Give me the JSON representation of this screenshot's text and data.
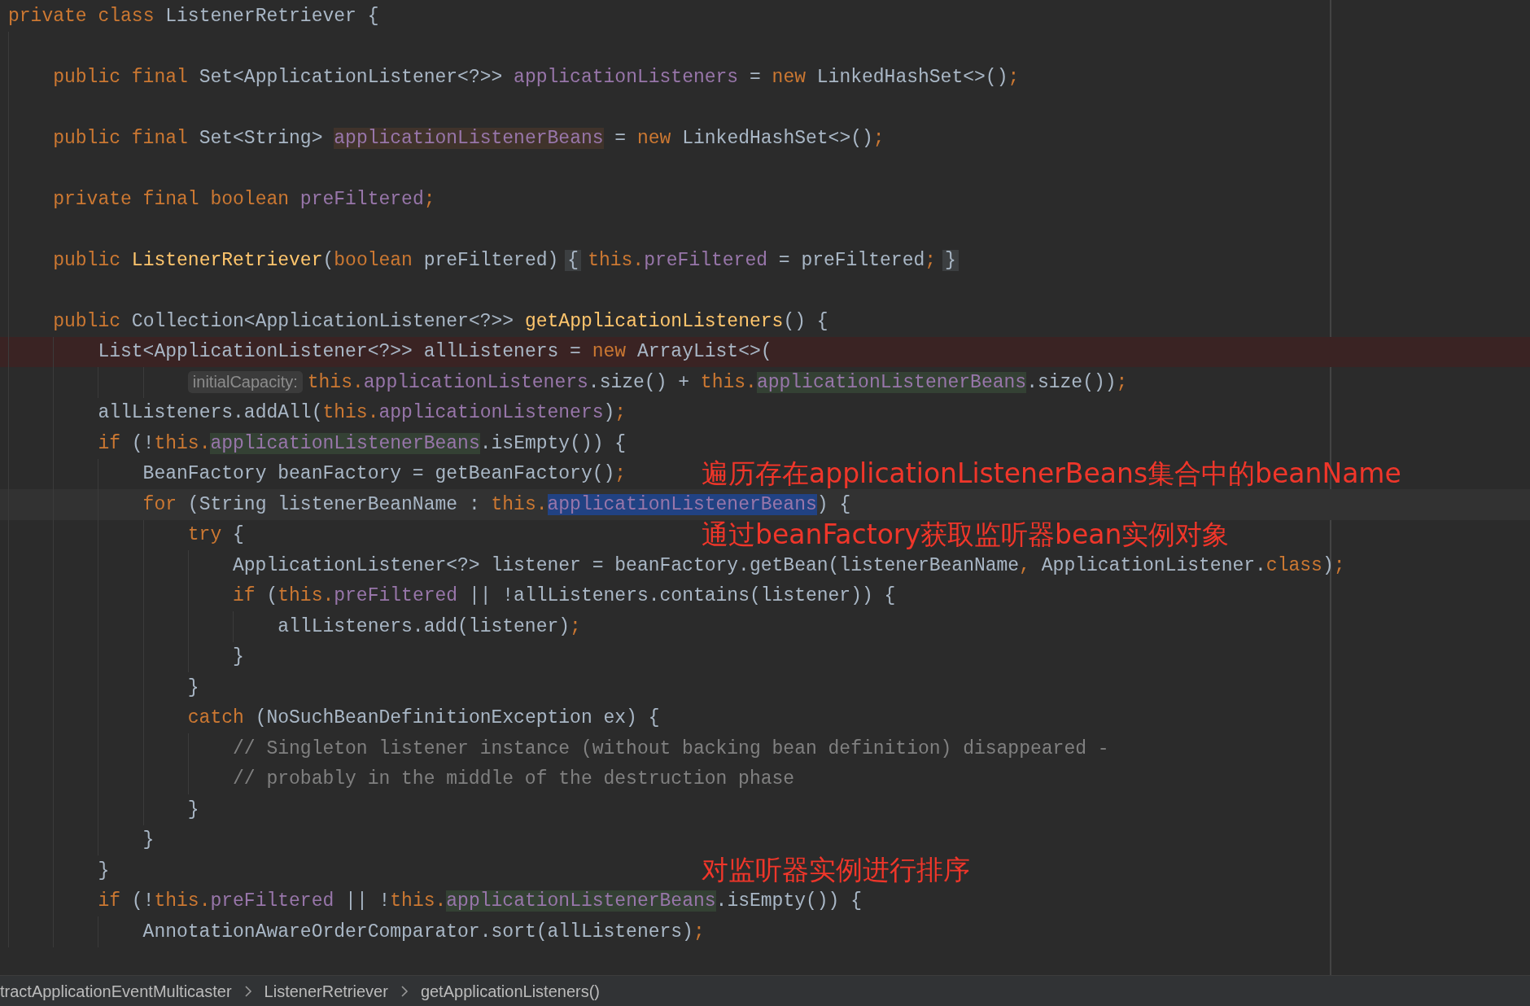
{
  "code": {
    "kind": "code",
    "tokens": [
      {
        "text": "private class ",
        "kind": "keyword"
      },
      {
        "text": "ListenerRetriever {",
        "kind": "plain"
      }
    ],
    "children": [
      {
        "kind": "blank"
      },
      {
        "kind": "code",
        "tokens": [
          {
            "text": "public final ",
            "kind": "keyword"
          },
          {
            "text": "Set<ApplicationListener<?>> ",
            "kind": "plain"
          },
          {
            "text": "applicationListeners",
            "kind": "field"
          },
          {
            "text": " = ",
            "kind": "plain"
          },
          {
            "text": "new ",
            "kind": "keyword"
          },
          {
            "text": "LinkedHashSet<>()",
            "kind": "plain"
          },
          {
            "text": ";",
            "kind": "keyword"
          }
        ]
      },
      {
        "kind": "blank"
      },
      {
        "kind": "code",
        "tokens": [
          {
            "text": "public final ",
            "kind": "keyword"
          },
          {
            "text": "Set<String> ",
            "kind": "plain"
          },
          {
            "text": "applicationListenerBeans",
            "kind": "field",
            "highlighted": true,
            "write_access": true
          },
          {
            "text": " = ",
            "kind": "plain"
          },
          {
            "text": "new ",
            "kind": "keyword"
          },
          {
            "text": "LinkedHashSet<>()",
            "kind": "plain"
          },
          {
            "text": ";",
            "kind": "keyword"
          }
        ]
      },
      {
        "kind": "blank"
      },
      {
        "kind": "code",
        "tokens": [
          {
            "text": "private final boolean ",
            "kind": "keyword"
          },
          {
            "text": "preFiltered",
            "kind": "field"
          },
          {
            "text": ";",
            "kind": "keyword"
          }
        ]
      },
      {
        "kind": "blank"
      },
      {
        "kind": "code",
        "tokens": [
          {
            "text": "public ",
            "kind": "keyword"
          },
          {
            "text": "ListenerRetriever",
            "kind": "method"
          },
          {
            "text": "(",
            "kind": "plain"
          },
          {
            "text": "boolean ",
            "kind": "keyword"
          },
          {
            "text": "preFiltered)",
            "kind": "plain"
          },
          {
            "text": "{",
            "kind": "fold"
          },
          {
            "text": "this.",
            "kind": "keyword"
          },
          {
            "text": "preFiltered",
            "kind": "field"
          },
          {
            "text": " = preFiltered",
            "kind": "plain"
          },
          {
            "text": ";",
            "kind": "keyword"
          },
          {
            "text": "}",
            "kind": "fold"
          }
        ]
      },
      {
        "kind": "blank"
      },
      {
        "kind": "code",
        "tokens": [
          {
            "text": "public ",
            "kind": "keyword"
          },
          {
            "text": "Collection<ApplicationListener<?>> ",
            "kind": "plain"
          },
          {
            "text": "getApplicationListeners",
            "kind": "method"
          },
          {
            "text": "() {",
            "kind": "plain"
          }
        ],
        "children": [
          {
            "kind": "breakpoint",
            "tokens": [
              {
                "text": "List<ApplicationListener<?>> allListeners = ",
                "kind": "plain"
              },
              {
                "text": "new ",
                "kind": "keyword"
              },
              {
                "text": "ArrayList<>(",
                "kind": "plain"
              }
            ],
            "continuation": {
              "hint": "initialCapacity:",
              "tokens": [
                {
                  "text": "this.",
                  "kind": "keyword"
                },
                {
                  "text": "applicationListeners",
                  "kind": "field"
                },
                {
                  "text": ".size() + ",
                  "kind": "plain"
                },
                {
                  "text": "this.",
                  "kind": "keyword"
                },
                {
                  "text": "applicationListenerBeans",
                  "kind": "field",
                  "highlighted": true
                },
                {
                  "text": ".size())",
                  "kind": "plain"
                },
                {
                  "text": ";",
                  "kind": "keyword"
                }
              ]
            }
          },
          {
            "kind": "code",
            "tokens": [
              {
                "text": "allListeners.addAll(",
                "kind": "plain"
              },
              {
                "text": "this.",
                "kind": "keyword"
              },
              {
                "text": "applicationListeners",
                "kind": "field"
              },
              {
                "text": ")",
                "kind": "plain"
              },
              {
                "text": ";",
                "kind": "keyword"
              }
            ]
          },
          {
            "kind": "code",
            "tokens": [
              {
                "text": "if ",
                "kind": "keyword"
              },
              {
                "text": "(!",
                "kind": "plain"
              },
              {
                "text": "this.",
                "kind": "keyword"
              },
              {
                "text": "applicationListenerBeans",
                "kind": "field",
                "highlighted": true
              },
              {
                "text": ".isEmpty()) {",
                "kind": "plain"
              }
            ],
            "end": "}",
            "end_note": "对监听器实例进行排序",
            "children": [
              {
                "kind": "code",
                "tokens": [
                  {
                    "text": "BeanFactory beanFactory = getBeanFactory()",
                    "kind": "plain"
                  },
                  {
                    "text": ";",
                    "kind": "keyword"
                  }
                ],
                "note": "遍历存在applicationListenerBeans集合中的beanName"
              },
              {
                "kind": "caret",
                "tokens": [
                  {
                    "text": "for ",
                    "kind": "keyword"
                  },
                  {
                    "text": "(String listenerBeanName : ",
                    "kind": "plain"
                  },
                  {
                    "text": "this.",
                    "kind": "keyword"
                  },
                  {
                    "text": "applicationListenerBeans",
                    "kind": "field",
                    "selection": true
                  },
                  {
                    "text": ") {",
                    "kind": "plain"
                  }
                ],
                "end": "}",
                "children": [
                  {
                    "kind": "code",
                    "tokens": [
                      {
                        "text": "try ",
                        "kind": "keyword"
                      },
                      {
                        "text": "{",
                        "kind": "plain"
                      }
                    ],
                    "note": "通过beanFactory获取监听器bean实例对象",
                    "end": "}",
                    "children": [
                      {
                        "kind": "code",
                        "tokens": [
                          {
                            "text": "ApplicationListener<?> listener = beanFactory.getBean(listenerBeanName",
                            "kind": "plain"
                          },
                          {
                            "text": ",",
                            "kind": "keyword"
                          },
                          {
                            "text": " ApplicationListener.",
                            "kind": "plain"
                          },
                          {
                            "text": "class",
                            "kind": "keyword"
                          },
                          {
                            "text": ")",
                            "kind": "plain"
                          },
                          {
                            "text": ";",
                            "kind": "keyword"
                          }
                        ]
                      },
                      {
                        "kind": "code",
                        "tokens": [
                          {
                            "text": "if ",
                            "kind": "keyword"
                          },
                          {
                            "text": "(",
                            "kind": "plain"
                          },
                          {
                            "text": "this.",
                            "kind": "keyword"
                          },
                          {
                            "text": "preFiltered",
                            "kind": "field"
                          },
                          {
                            "text": " || !allListeners.contains(listener)) {",
                            "kind": "plain"
                          }
                        ],
                        "end": "}",
                        "children": [
                          {
                            "kind": "code",
                            "tokens": [
                              {
                                "text": "allListeners.add(listener)",
                                "kind": "plain"
                              },
                              {
                                "text": ";",
                                "kind": "keyword"
                              }
                            ]
                          }
                        ]
                      }
                    ]
                  },
                  {
                    "kind": "code",
                    "tokens": [
                      {
                        "text": "catch ",
                        "kind": "keyword"
                      },
                      {
                        "text": "(NoSuchBeanDefinitionException ex) {",
                        "kind": "plain"
                      }
                    ],
                    "end": "}",
                    "children": [
                      {
                        "kind": "code",
                        "tokens": [
                          {
                            "text": "// Singleton listener instance (without backing bean definition) disappeared -",
                            "kind": "comment"
                          }
                        ]
                      },
                      {
                        "kind": "code",
                        "tokens": [
                          {
                            "text": "// probably in the middle of the destruction phase",
                            "kind": "comment"
                          }
                        ]
                      }
                    ]
                  }
                ]
              }
            ]
          },
          {
            "kind": "code",
            "tokens": [
              {
                "text": "if ",
                "kind": "keyword"
              },
              {
                "text": "(!",
                "kind": "plain"
              },
              {
                "text": "this.",
                "kind": "keyword"
              },
              {
                "text": "preFiltered",
                "kind": "field"
              },
              {
                "text": " || !",
                "kind": "plain"
              },
              {
                "text": "this.",
                "kind": "keyword"
              },
              {
                "text": "applicationListenerBeans",
                "kind": "field",
                "highlighted": true
              },
              {
                "text": ".isEmpty()) {",
                "kind": "plain"
              }
            ],
            "children": [
              {
                "kind": "code",
                "tokens": [
                  {
                    "text": "AnnotationAwareOrderComparator.sort(allListeners)",
                    "kind": "plain"
                  },
                  {
                    "text": ";",
                    "kind": "keyword"
                  }
                ]
              }
            ]
          }
        ]
      }
    ]
  },
  "breadcrumbs": [
    "tractApplicationEventMulticaster",
    "ListenerRetriever",
    "getApplicationListeners()"
  ]
}
